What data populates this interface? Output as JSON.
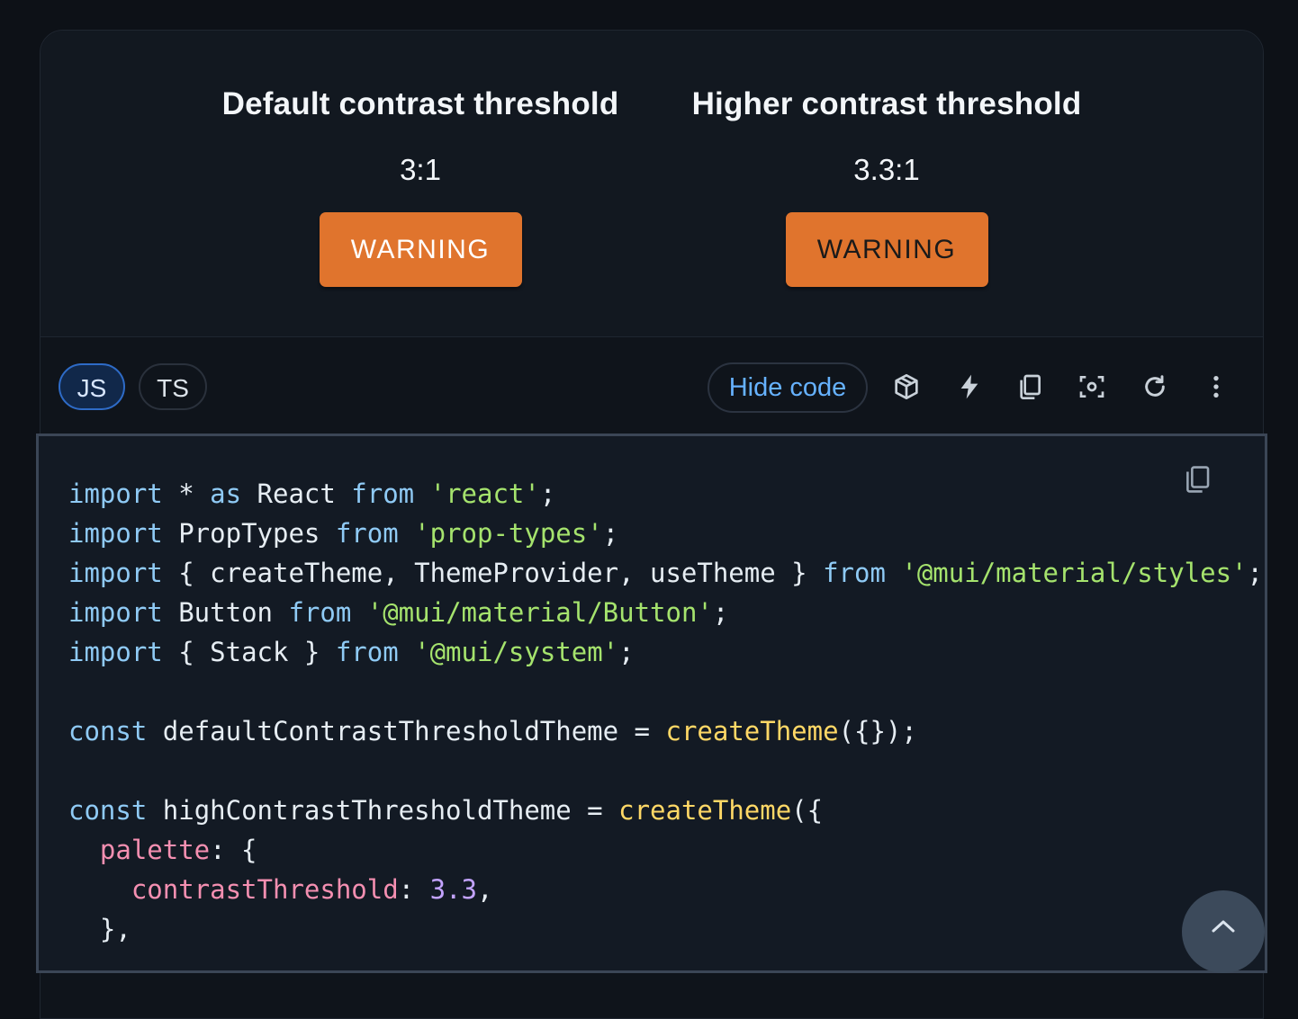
{
  "preview": {
    "left": {
      "title": "Default contrast threshold",
      "ratio": "3:1",
      "button": "WARNING"
    },
    "right": {
      "title": "Higher contrast threshold",
      "ratio": "3.3:1",
      "button": "WARNING"
    }
  },
  "toolbar": {
    "js_label": "JS",
    "ts_label": "TS",
    "hide_code_label": "Hide code",
    "icons": [
      "sandbox-icon",
      "lightning-icon",
      "copy-icon",
      "focus-icon",
      "reset-icon",
      "more-vert-icon"
    ]
  },
  "code": {
    "l1": {
      "import": "import",
      "star": " * ",
      "as": "as",
      "name": " React ",
      "from": "from",
      "space": " ",
      "module": "'react'",
      "end": ";"
    },
    "l2": {
      "import": "import",
      "name": " PropTypes ",
      "from": "from",
      "space": " ",
      "module": "'prop-types'",
      "end": ";"
    },
    "l3": {
      "import": "import",
      "name": " { createTheme, ThemeProvider, useTheme } ",
      "from": "from",
      "space": " ",
      "module": "'@mui/material/styles'",
      "end": ";"
    },
    "l4": {
      "import": "import",
      "name": " Button ",
      "from": "from",
      "space": " ",
      "module": "'@mui/material/Button'",
      "end": ";"
    },
    "l5": {
      "import": "import",
      "name": " { Stack } ",
      "from": "from",
      "space": " ",
      "module": "'@mui/system'",
      "end": ";"
    },
    "l7": {
      "const": "const",
      "name": " defaultContrastThresholdTheme = ",
      "fn": "createTheme",
      "end": "({});"
    },
    "l9": {
      "const": "const",
      "name": " highContrastThresholdTheme = ",
      "fn": "createTheme",
      "end": "({"
    },
    "l10": {
      "indent": "  ",
      "prop": "palette",
      "end": ": {"
    },
    "l11": {
      "indent": "    ",
      "prop": "contrastThreshold",
      "colon": ": ",
      "num": "3.3",
      "end": ","
    },
    "l12": {
      "text": "  },"
    }
  },
  "colors": {
    "warning": "#e0742d",
    "accent": "#66b2ff",
    "keyword": "#8fcaf5",
    "string": "#a5e36d",
    "function": "#ffd866",
    "property": "#f48fb1",
    "number": "#c3a3ff"
  }
}
